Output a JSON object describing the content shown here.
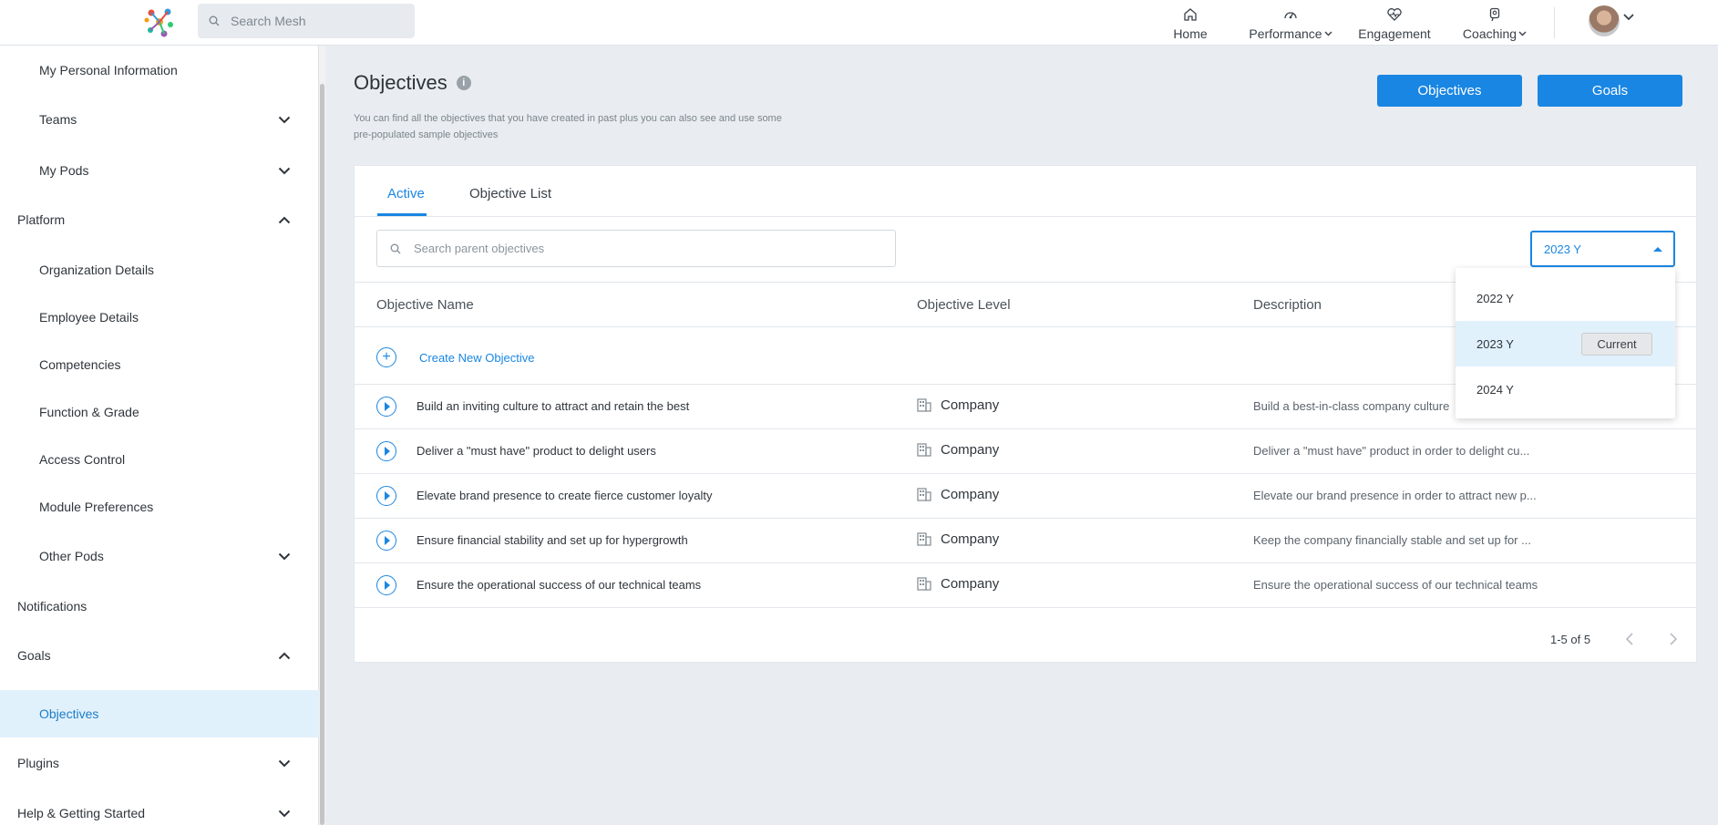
{
  "header": {
    "search_placeholder": "Search Mesh",
    "nav": [
      {
        "label": "Home",
        "icon": "home-icon"
      },
      {
        "label": "Performance",
        "icon": "performance-icon"
      },
      {
        "label": "Engagement",
        "icon": "engagement-icon"
      },
      {
        "label": "Coaching",
        "icon": "coaching-icon"
      }
    ]
  },
  "sidebar": {
    "items": [
      {
        "label": "My Personal Information"
      },
      {
        "label": "Teams"
      },
      {
        "label": "My Pods"
      },
      {
        "label": "Platform"
      },
      {
        "label": "Organization Details"
      },
      {
        "label": "Employee Details"
      },
      {
        "label": "Competencies"
      },
      {
        "label": "Function & Grade"
      },
      {
        "label": "Access Control"
      },
      {
        "label": "Module Preferences"
      },
      {
        "label": "Other Pods"
      },
      {
        "label": "Notifications"
      },
      {
        "label": "Goals"
      },
      {
        "label": "Objectives"
      },
      {
        "label": "Plugins"
      },
      {
        "label": "Help & Getting Started"
      }
    ]
  },
  "page": {
    "title": "Objectives",
    "description": "You can find all the objectives that you have created in past plus you can also see and use some pre-populated sample objectives",
    "buttons": {
      "objectives": "Objectives",
      "goals": "Goals"
    }
  },
  "tabs": [
    {
      "label": "Active"
    },
    {
      "label": "Objective List"
    }
  ],
  "search": {
    "placeholder": "Search parent objectives"
  },
  "year_select": {
    "value": "2023 Y",
    "options": [
      {
        "label": "2022 Y"
      },
      {
        "label": "2023 Y",
        "badge": "Current"
      },
      {
        "label": "2024 Y"
      }
    ]
  },
  "table": {
    "columns": [
      "Objective Name",
      "Objective Level",
      "Description"
    ],
    "create_label": "Create New Objective",
    "rows": [
      {
        "name": "Build an inviting culture to attract and retain the best",
        "level": "Company",
        "description": "Build a best-in-class company culture"
      },
      {
        "name": "Deliver a \"must have\" product to delight users",
        "level": "Company",
        "description": "Deliver a \"must have\" product in order to delight cu..."
      },
      {
        "name": "Elevate brand presence to create fierce customer loyalty",
        "level": "Company",
        "description": "Elevate our brand presence in order to attract new p..."
      },
      {
        "name": "Ensure financial stability and set up for hypergrowth",
        "level": "Company",
        "description": "Keep the company financially stable and set up for ..."
      },
      {
        "name": "Ensure the operational success of our technical teams",
        "level": "Company",
        "description": "Ensure the operational success of our technical teams"
      }
    ],
    "pagination": "1-5 of 5"
  },
  "colors": {
    "accent": "#1a86e3",
    "active_bg": "#e1f1fc",
    "page_bg": "#e9edf1"
  }
}
